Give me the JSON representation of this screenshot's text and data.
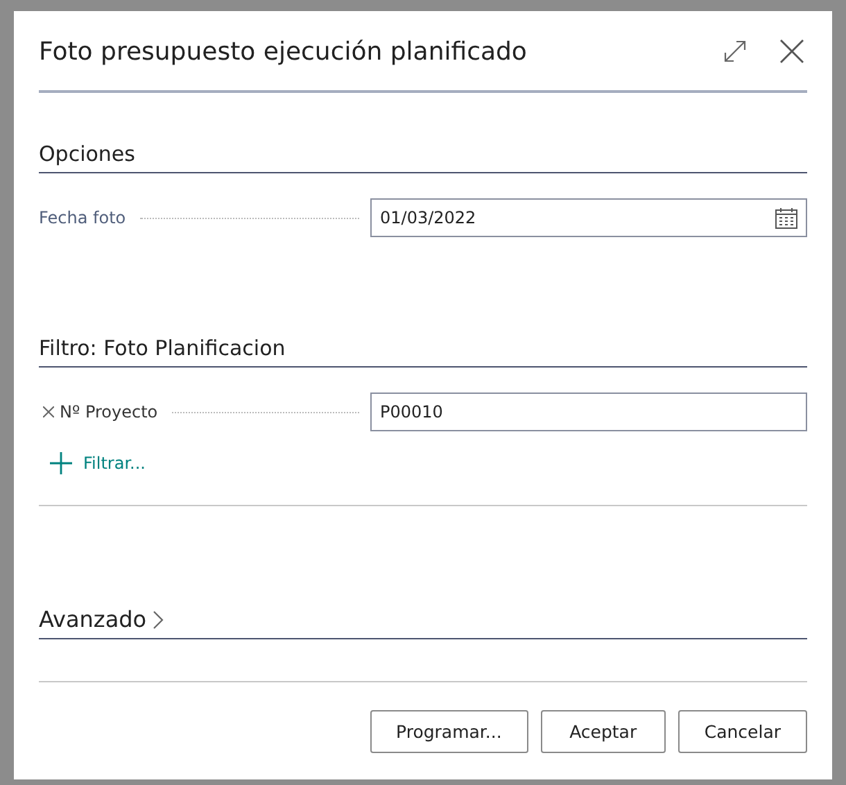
{
  "dialog": {
    "title": "Foto presupuesto ejecución planificado",
    "sections": [
      {
        "kind": "fields",
        "title": "Opciones",
        "fields": [
          {
            "label": "Fecha foto",
            "value": "01/03/2022",
            "kind": "date"
          }
        ]
      },
      {
        "kind": "filters",
        "title": "Filtro: Foto Planificacion",
        "filters": [
          {
            "label": "Nº Proyecto",
            "value": "P00010"
          }
        ],
        "add_filter": "Filtrar..."
      },
      {
        "kind": "collapsible",
        "title": "Avanzado",
        "expanded": false
      }
    ],
    "buttons": [
      "Programar...",
      "Aceptar",
      "Cancelar"
    ]
  }
}
